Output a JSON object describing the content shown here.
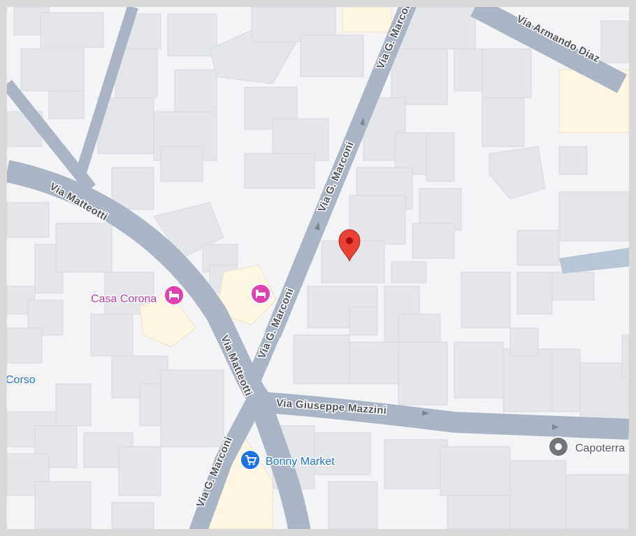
{
  "map": {
    "colors": {
      "background": "#f4f4f6",
      "building": "#e4e6ea",
      "building_highlight": "#fdf6e3",
      "road": "#aab6c5",
      "water": "#b8c6d6",
      "pin": "#ea4335",
      "hotel_marker": "#e040b0",
      "shop_marker": "#1a73e8",
      "place_marker": "#70757a"
    },
    "streets": {
      "armando_diaz": "Via Armando Diaz",
      "marconi_top": "Via G. Marconi",
      "marconi_mid": "Via G. Marconi",
      "marconi_low": "Via G. Marconi",
      "marconi_bottom": "Via G. Marconi",
      "matteotti_upper": "Via Matteotti",
      "matteotti_lower": "Via Matteotti",
      "mazzini": "Via Giuseppe Mazzini"
    },
    "pois": {
      "casa_corona": {
        "label": "Casa Corona",
        "icon": "hotel-icon"
      },
      "hotel_unnamed": {
        "icon": "hotel-icon"
      },
      "bonny_market": {
        "label": "Bonny Market",
        "icon": "shopping-cart-icon"
      },
      "capoterra": {
        "label": "Capoterra",
        "icon": "place-icon"
      },
      "corso": {
        "label": "Corso"
      }
    },
    "pin": {
      "icon": "map-pin-icon"
    }
  }
}
